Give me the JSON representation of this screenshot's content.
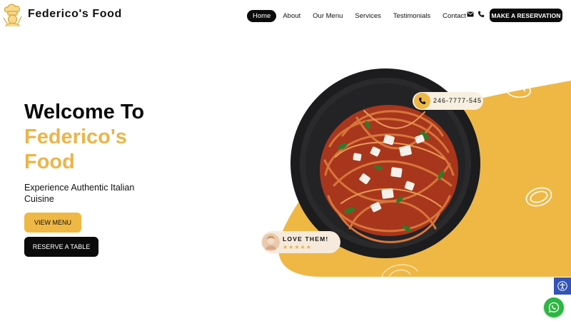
{
  "header": {
    "brand": "Federico's Food",
    "logo_icon": "chef-hat-logo-icon",
    "nav": [
      {
        "label": "Home",
        "active": true
      },
      {
        "label": "About",
        "active": false
      },
      {
        "label": "Our Menu",
        "active": false
      },
      {
        "label": "Services",
        "active": false
      },
      {
        "label": "Testimonials",
        "active": false
      },
      {
        "label": "Contact",
        "active": false
      }
    ],
    "contact_icons": [
      "envelope-icon",
      "phone-icon"
    ],
    "cta_label": "MAKE A RESERVATION"
  },
  "hero": {
    "title_line1": "Welcome To",
    "title_line2": "Federico's",
    "title_line3": "Food",
    "subtitle": "Experience Authentic Italian Cuisine",
    "view_menu_label": "VIEW MENU",
    "reserve_table_label": "RESERVE A TABLE",
    "phone_number": "246-7777-545",
    "review_label": "LOVE THEM!",
    "review_stars": "★★★★★",
    "image_subject": "spaghetti-pasta-plate"
  },
  "widgets": {
    "accessibility_icon": "accessibility-icon",
    "whatsapp_icon": "whatsapp-icon"
  },
  "colors": {
    "accent": "#efb845",
    "accent_text": "#eab54a",
    "dark": "#0b0b0b",
    "pill_bg": "#f7efe0",
    "whatsapp": "#2bb741",
    "a11y": "#3254b6"
  }
}
